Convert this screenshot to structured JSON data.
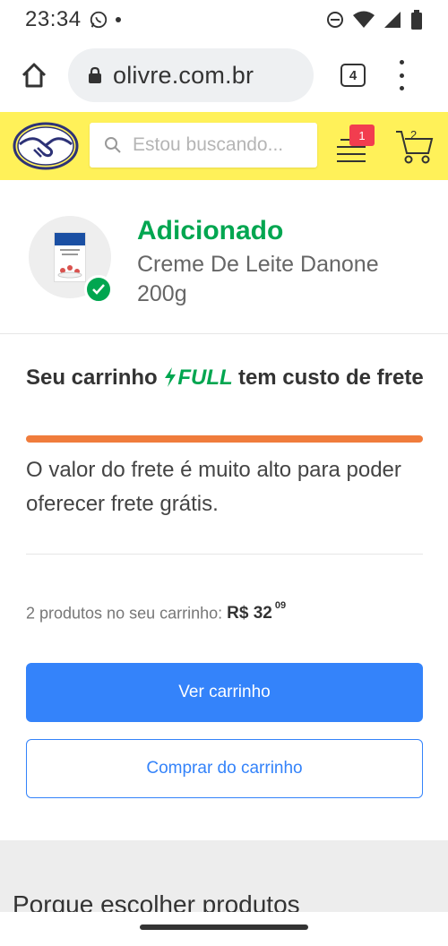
{
  "status_bar": {
    "time": "23:34",
    "icons": [
      "whatsapp-icon",
      "dnd-icon",
      "wifi-icon",
      "signal-icon",
      "battery-icon"
    ]
  },
  "browser": {
    "url": "olivre.com.br",
    "tab_count": "4"
  },
  "header": {
    "search_placeholder": "Estou buscando...",
    "notification_count": "1",
    "cart_count": "2",
    "brand_color": "#fff159"
  },
  "added": {
    "title": "Adicionado",
    "product_name": "Creme De Leite Danone 200g",
    "accent_color": "#00a650"
  },
  "shipping": {
    "title_prefix": "Seu carrinho",
    "full_label": "FULL",
    "title_suffix": "tem custo de frete",
    "description": "O valor do frete é muito alto para poder oferecer frete grátis.",
    "bar_color": "#f07c3c"
  },
  "cart": {
    "summary_text": "2 produtos no seu carrinho:",
    "price_main": "R$ 32",
    "price_cents": "09"
  },
  "buttons": {
    "view_cart": "Ver carrinho",
    "buy_from_cart": "Comprar do carrinho",
    "primary_color": "#3483fa"
  },
  "footer": {
    "heading": "Porque escolher produtos"
  }
}
